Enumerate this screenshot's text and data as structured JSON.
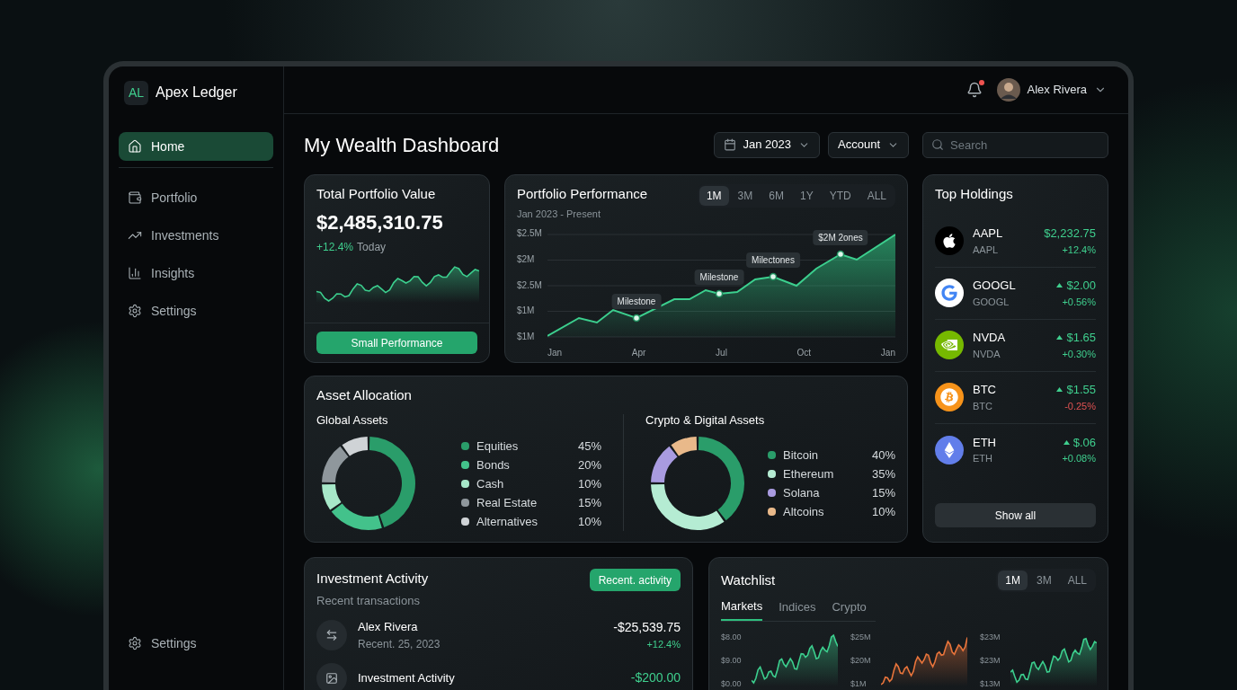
{
  "brand": {
    "initials": "AL",
    "name": "Apex Ledger"
  },
  "sidebar": {
    "items": [
      {
        "label": "Home",
        "selected": true
      },
      {
        "label": "Portfolio",
        "selected": false
      },
      {
        "label": "Investments",
        "selected": false
      },
      {
        "label": "Insights",
        "selected": false
      },
      {
        "label": "Settings",
        "selected": false
      }
    ],
    "footer_item": {
      "label": "Settings"
    }
  },
  "header": {
    "notification_dot": true,
    "user": {
      "name": "Alex Rivera"
    }
  },
  "page_title": "My Wealth Dashboard",
  "filters": {
    "date": "Jan 2023",
    "account": "Account",
    "search": {
      "placeholder": "Search"
    }
  },
  "portfolio_value": {
    "title": "Total Portfolio Value",
    "value": "$2,485,310.75",
    "change": "+12.4%",
    "change_label": "Today",
    "button": "Small Performance"
  },
  "performance": {
    "title": "Portfolio Performance",
    "subtitle": "Jan 2023 - Present",
    "ranges": [
      {
        "label": "1M",
        "selected": true
      },
      {
        "label": "3M",
        "selected": false
      },
      {
        "label": "6M",
        "selected": false
      },
      {
        "label": "1Y",
        "selected": false
      },
      {
        "label": "YTD",
        "selected": false
      },
      {
        "label": "ALL",
        "selected": false
      }
    ],
    "y_axis_labels": [
      "$2.5M",
      "$2M",
      "$2.5M",
      "$1M",
      "$1M"
    ],
    "x_axis_labels": [
      "Jan",
      "Apr",
      "Jul",
      "Oct",
      "Jan"
    ],
    "markers": [
      "Milestone",
      "Milestone",
      "Milectones",
      "$2M 2ones"
    ]
  },
  "holdings": {
    "title": "Top Holdings",
    "items": [
      {
        "symbol": "AAPL",
        "sub": "AAPL",
        "price": "$2,232.75",
        "up_arrow": false,
        "change": "+12.4%",
        "negative": false,
        "color": "#000000"
      },
      {
        "symbol": "GOOGL",
        "sub": "GOOGL",
        "price": "$2.00",
        "up_arrow": true,
        "change": "+0.56%",
        "negative": false,
        "color": "#ffffff"
      },
      {
        "symbol": "NVDA",
        "sub": "NVDA",
        "price": "$1.65",
        "up_arrow": true,
        "change": "+0.30%",
        "negative": false,
        "color": "#76b900"
      },
      {
        "symbol": "BTC",
        "sub": "BTC",
        "price": "$1.55",
        "up_arrow": true,
        "change": "-0.25%",
        "negative": true,
        "color": "#f7931a"
      },
      {
        "symbol": "ETH",
        "sub": "ETH",
        "price": "$.06",
        "up_arrow": true,
        "change": "+0.08%",
        "negative": false,
        "color": "#627eea"
      }
    ],
    "button": "Show all"
  },
  "allocation": {
    "title": "Asset Allocation",
    "groups": [
      {
        "chart_data": {
          "type": "donut",
          "title": "Global Assets",
          "categories": [
            "Equities",
            "Bonds",
            "Cash",
            "Real Estate",
            "Alternatives"
          ],
          "values": [
            45,
            20,
            10,
            15,
            10
          ],
          "colors": [
            "#2a9d6a",
            "#43c28b",
            "#a7e8c9",
            "#8f979c",
            "#cfd3d6"
          ],
          "value_labels": [
            "45%",
            "20%",
            "10%",
            "15%",
            "10%"
          ]
        }
      },
      {
        "chart_data": {
          "type": "donut",
          "title": "Crypto & Digital Assets",
          "categories": [
            "Bitcoin",
            "Ethereum",
            "Solana",
            "Altcoins"
          ],
          "values": [
            40,
            35,
            15,
            10
          ],
          "colors": [
            "#2a9d6a",
            "#b5ecd3",
            "#a99be0",
            "#e9b98a"
          ],
          "value_labels": [
            "40%",
            "35%",
            "15%",
            "10%"
          ]
        }
      }
    ]
  },
  "activity": {
    "title": "Investment Activity",
    "subtitle": "Recent transactions",
    "button": "Recent. activity",
    "rows": [
      {
        "name": "Alex Rivera",
        "detail": "Recent. 25, 2023",
        "amount": "-$25,539.75",
        "change": "+12.4%",
        "highlight": false
      },
      {
        "name": "Investment Activity",
        "amount": "-$200.00",
        "highlight": true
      }
    ]
  },
  "watchlist": {
    "title": "Watchlist",
    "ranges": [
      {
        "label": "1M",
        "selected": true
      },
      {
        "label": "3M",
        "selected": false
      },
      {
        "label": "ALL",
        "selected": false
      }
    ],
    "tabs": [
      {
        "label": "Markets",
        "selected": true
      },
      {
        "label": "Indices",
        "selected": false
      },
      {
        "label": "Crypto",
        "selected": false
      }
    ],
    "charts": [
      {
        "color": "#3ccf8e",
        "y_axis_labels": [
          "$8.00",
          "$9.00",
          "$0.00"
        ]
      },
      {
        "color": "#e8743b",
        "y_axis_labels": [
          "$25M",
          "$20M",
          "$1M"
        ]
      },
      {
        "color": "#3ccf8e",
        "y_axis_labels": [
          "$23M",
          "$23M",
          "$13M"
        ]
      }
    ]
  }
}
